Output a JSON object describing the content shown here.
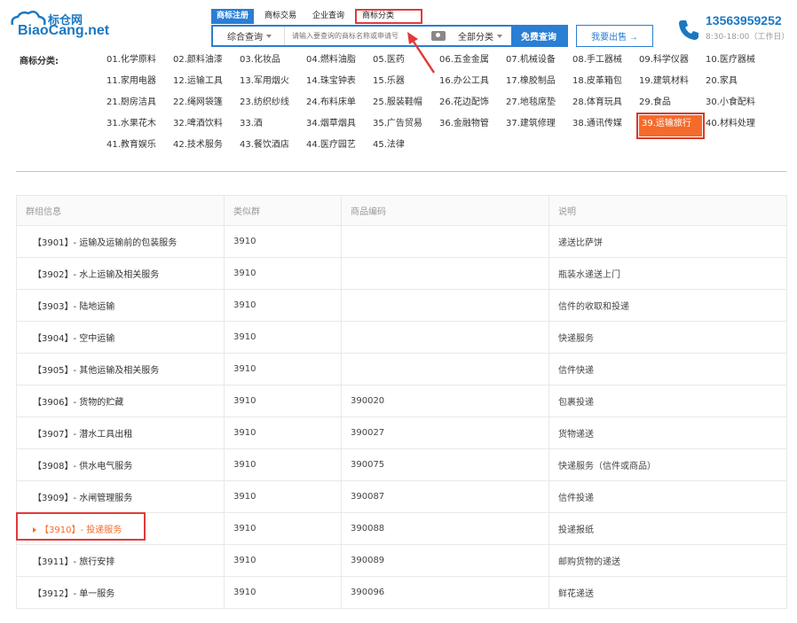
{
  "logo": {
    "cn": "标仓网",
    "en": "BiaoCang.net"
  },
  "tabs": [
    {
      "label": "商标注册"
    },
    {
      "label": "商标交易"
    },
    {
      "label": "企业查询"
    },
    {
      "label": "商标分类"
    }
  ],
  "search": {
    "type": "综合查询",
    "placeholder": "请输入要查询的商标名称或申请号",
    "category": "全部分类",
    "button": "免费查询"
  },
  "sell_button": "我要出售 →",
  "contact": {
    "phone": "13563959252",
    "hours": "8:30-18:00（工作日）"
  },
  "categories": {
    "label": "商标分类:",
    "items": [
      "01.化学原料",
      "02.颜料油漆",
      "03.化妆品",
      "04.燃料油脂",
      "05.医药",
      "06.五金金属",
      "07.机械设备",
      "08.手工器械",
      "09.科学仪器",
      "10.医疗器械",
      "11.家用电器",
      "12.运输工具",
      "13.军用烟火",
      "14.珠宝钟表",
      "15.乐器",
      "16.办公工具",
      "17.橡胶制品",
      "18.皮革箱包",
      "19.建筑材料",
      "20.家具",
      "21.厨房洁具",
      "22.绳网袋篷",
      "23.纺织纱线",
      "24.布料床单",
      "25.服装鞋帽",
      "26.花边配饰",
      "27.地毯席垫",
      "28.体育玩具",
      "29.食品",
      "30.小食配料",
      "31.水果花木",
      "32.啤酒饮料",
      "33.酒",
      "34.烟草烟具",
      "35.广告贸易",
      "36.金融物管",
      "37.建筑修理",
      "38.通讯传媒",
      "39.运输旅行",
      "40.材料处理",
      "41.教育娱乐",
      "42.技术服务",
      "43.餐饮酒店",
      "44.医疗园艺",
      "45.法律"
    ],
    "selected_index": 38
  },
  "table": {
    "headers": [
      "群组信息",
      "类似群",
      "商品编码",
      "说明"
    ],
    "rows": [
      [
        "【3901】- 运输及运输前的包装服务",
        "3910",
        "",
        "递送比萨饼"
      ],
      [
        "【3902】- 水上运输及相关服务",
        "3910",
        "",
        "瓶装水递送上门"
      ],
      [
        "【3903】- 陆地运输",
        "3910",
        "",
        "信件的收取和投递"
      ],
      [
        "【3904】- 空中运输",
        "3910",
        "",
        "快递服务"
      ],
      [
        "【3905】- 其他运输及相关服务",
        "3910",
        "",
        "信件快递"
      ],
      [
        "【3906】- 货物的贮藏",
        "3910",
        "390020",
        "包裹投递"
      ],
      [
        "【3907】- 潜水工具出租",
        "3910",
        "390027",
        "货物递送"
      ],
      [
        "【3908】- 供水电气服务",
        "3910",
        "390075",
        "快递服务（信件或商品）"
      ],
      [
        "【3909】- 水闸管理服务",
        "3910",
        "390087",
        "信件投递"
      ],
      [
        "【3910】- 投递服务",
        "3910",
        "390088",
        "投递报纸"
      ],
      [
        "【3911】- 旅行安排",
        "3910",
        "390089",
        "邮购货物的递送"
      ],
      [
        "【3912】- 单一服务",
        "3910",
        "390096",
        "鲜花递送"
      ]
    ],
    "highlight_row": 9
  },
  "colors": {
    "brand": "#2a7ed3",
    "accent": "#f46b2b",
    "annotation": "#e03a3a"
  }
}
